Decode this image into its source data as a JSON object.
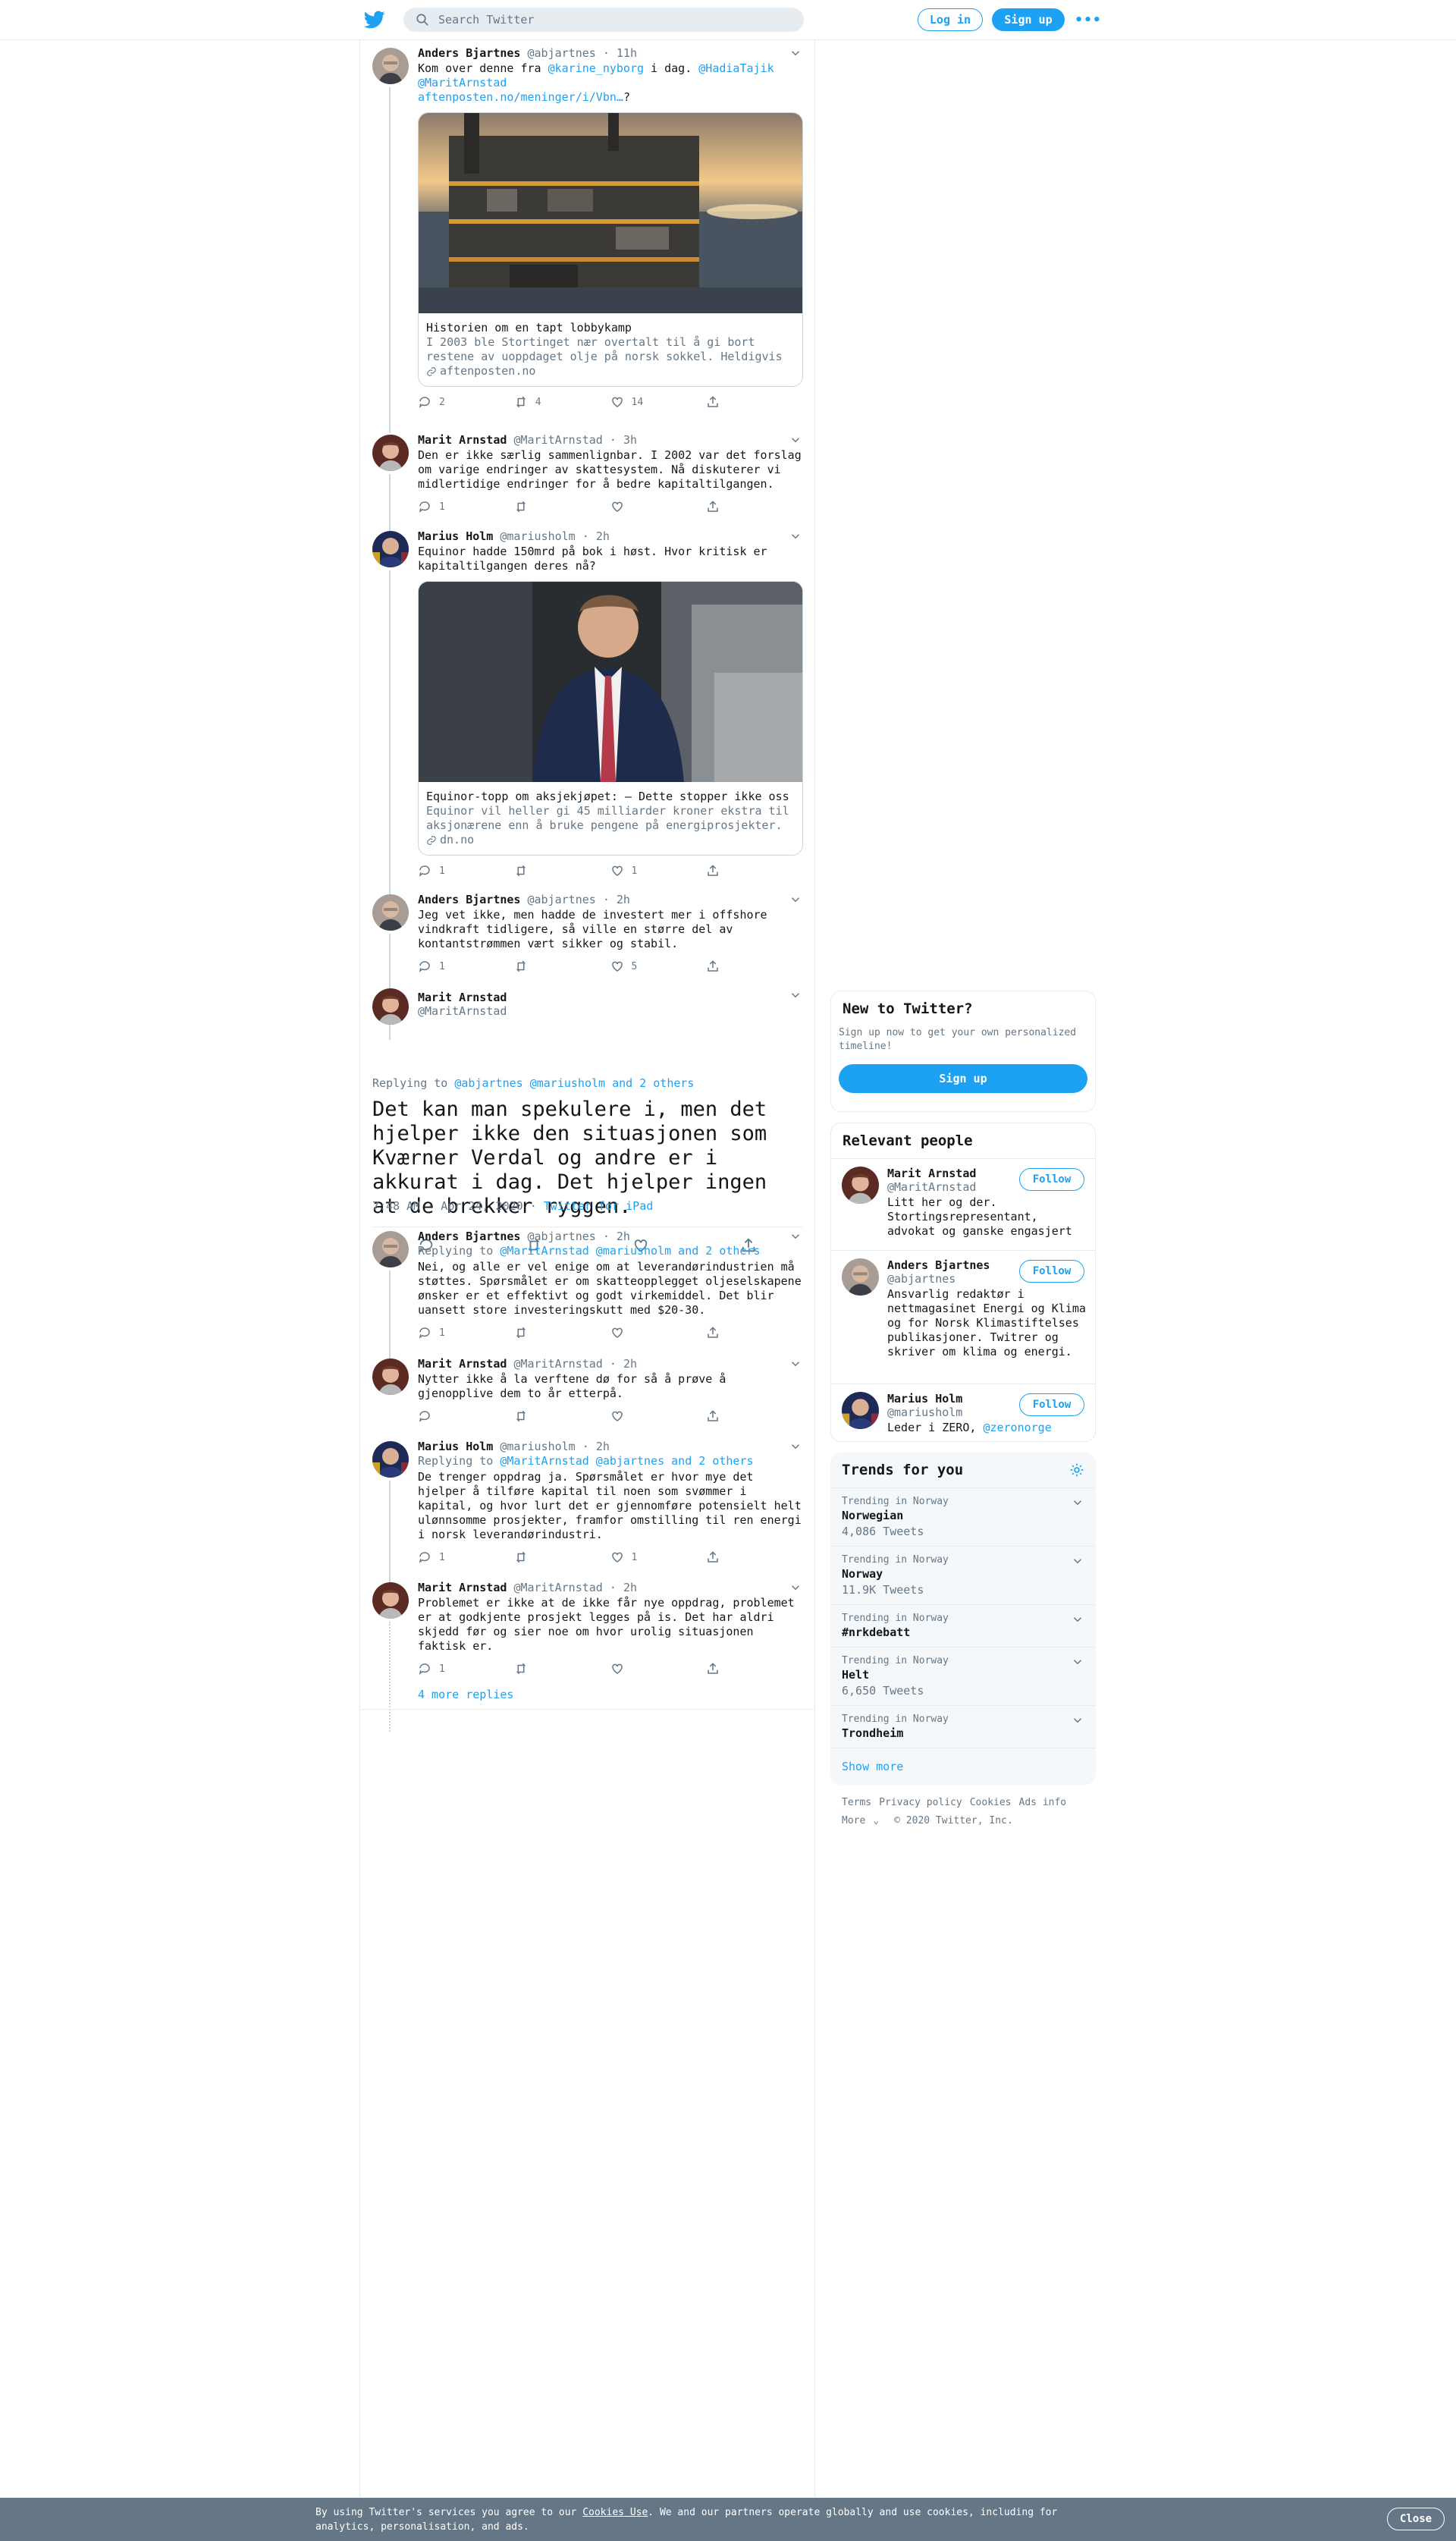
{
  "topbar": {
    "search_placeholder": "Search Twitter",
    "login_label": "Log in",
    "signup_label": "Sign up",
    "more_label": "•••"
  },
  "tweets": [
    {
      "name": "Anders Bjartnes",
      "handle": "@abjartnes",
      "time": "11h",
      "text_parts": [
        "Kom over denne fra ",
        "@karine_nyborg",
        " i dag. ",
        "@HadiaTajik",
        "@MaritArnstad",
        "aftenposten.no/meninger/i/Vbn…",
        "?"
      ],
      "card": {
        "title": "Historien om en tapt lobbykamp",
        "desc": "I 2003 ble Stortinget nær overtalt til å gi bort restene av uoppdaget olje på norsk sokkel. Heldigvis …",
        "host": "aftenposten.no"
      },
      "replies": "2",
      "retweets": "4",
      "likes": "14"
    },
    {
      "name": "Marit Arnstad",
      "handle": "@MaritArnstad",
      "time": "3h",
      "text": "Den er ikke særlig sammenlignbar. I 2002 var det forslag om varige endringer av skattesystem. Nå diskuterer vi midlertidige endringer for å bedre kapitaltilgangen.",
      "replies": "1",
      "retweets": "",
      "likes": ""
    },
    {
      "name": "Marius Holm",
      "handle": "@mariusholm",
      "time": "2h",
      "text": "Equinor hadde 150mrd på bok i høst. Hvor kritisk er kapitaltilgangen deres nå?",
      "card": {
        "title": "Equinor-topp om aksjekjøpet: – Dette stopper ikke oss",
        "desc": "Equinor vil heller gi 45 milliarder kroner ekstra til aksjonærene enn å bruke pengene på energiprosjekter. …",
        "host": "dn.no"
      },
      "replies": "1",
      "retweets": "",
      "likes": "1"
    },
    {
      "name": "Anders Bjartnes",
      "handle": "@abjartnes",
      "time": "2h",
      "text": "Jeg vet ikke, men hadde de investert mer i offshore vindkraft tidligere, så ville en større del av kontantstrømmen vært sikker og stabil.",
      "replies": "1",
      "retweets": "",
      "likes": "5"
    }
  ],
  "focused": {
    "name": "Marit Arnstad",
    "handle": "@MaritArnstad",
    "replying_prefix": "Replying to ",
    "replying_to": "@abjartnes @mariusholm and 2 others",
    "text": "Det kan man spekulere i, men det hjelper ikke den situasjonen som Kværner Verdal og andre er i akkurat i dag. Det hjelper ingen at de brekker ryggen.",
    "datetime": "7:48 AM · Apr 24, 2020 · ",
    "source": "Twitter for iPad"
  },
  "replies": [
    {
      "name": "Anders Bjartnes",
      "handle": "@abjartnes",
      "time": "2h",
      "replying_to": "@MaritArnstad @mariusholm and 2 others",
      "text": "Nei, og alle er vel enige om at leverandørindustrien må støttes. Spørsmålet er om skatteopplegget oljeselskapene ønsker er et effektivt og godt virkemiddel. Det blir uansett store investeringskutt med $20-30.",
      "replies": "1",
      "retweets": "",
      "likes": ""
    },
    {
      "name": "Marit Arnstad",
      "handle": "@MaritArnstad",
      "time": "2h",
      "text": "Nytter ikke å la verftene dø for så å prøve å gjenopplive dem to år etterpå.",
      "replies": "",
      "retweets": "",
      "likes": ""
    },
    {
      "name": "Marius Holm",
      "handle": "@mariusholm",
      "time": "2h",
      "replying_to": "@MaritArnstad @abjartnes and 2 others",
      "text": "De trenger oppdrag ja. Spørsmålet er hvor mye det hjelper å tilføre kapital til noen som svømmer i kapital, og hvor lurt det er gjennomføre potensielt helt ulønnsomme prosjekter, framfor omstilling til ren energi i norsk leverandørindustri.",
      "replies": "1",
      "retweets": "",
      "likes": "1"
    },
    {
      "name": "Marit Arnstad",
      "handle": "@MaritArnstad",
      "time": "2h",
      "text": "Problemet er ikke at de ikke får nye oppdrag, problemet er at godkjente prosjekt legges på is. Det har aldri skjedd før og sier noe om hvor urolig situasjonen faktisk er.",
      "replies": "1",
      "retweets": "",
      "likes": ""
    }
  ],
  "more_replies": "4 more replies",
  "sidebar": {
    "new_title": "New to Twitter?",
    "new_sub": "Sign up now to get your own personalized timeline!",
    "signup_label": "Sign up",
    "relevant_title": "Relevant people",
    "follow_label": "Follow",
    "people": [
      {
        "name": "Marit Arnstad",
        "handle": "@MaritArnstad",
        "bio": "Litt her og der. Stortingsrepresentant, advokat og ganske engasjert"
      },
      {
        "name": "Anders Bjartnes",
        "handle": "@abjartnes",
        "bio": "Ansvarlig redaktør i nettmagasinet Energi og Klima og for Norsk Klimastiftelses publikasjoner. Twitrer og skriver om klima og energi."
      },
      {
        "name": "Marius Holm",
        "handle": "@mariusholm",
        "bio_prefix": "Leder i ZERO, ",
        "bio_link": "@zeronorge"
      }
    ],
    "trends_title": "Trends for you",
    "trends": [
      {
        "context": "Trending in Norway",
        "name": "Norwegian",
        "count": "4,086 Tweets"
      },
      {
        "context": "Trending in Norway",
        "name": "Norway",
        "count": "11.9K Tweets"
      },
      {
        "context": "Trending in Norway",
        "name": "#nrkdebatt",
        "count": ""
      },
      {
        "context": "Trending in Norway",
        "name": "Helt",
        "count": "6,650 Tweets"
      },
      {
        "context": "Trending in Norway",
        "name": "Trondheim",
        "count": ""
      }
    ],
    "show_more": "Show more",
    "footer_links": [
      "Terms",
      "Privacy policy",
      "Cookies",
      "Ads info"
    ],
    "footer_more": "More",
    "copyright": "© 2020 Twitter, Inc."
  },
  "cookie": {
    "text_before": "By using Twitter's services you agree to our ",
    "link": "Cookies Use",
    "text_after": ". We and our partners operate globally and use cookies, including for analytics, personalisation, and ads.",
    "close_label": "Close"
  },
  "colors": {
    "accent": "#1da1f2",
    "muted": "#657786",
    "border": "#e6ecf0",
    "cookie_bg": "#657786"
  }
}
